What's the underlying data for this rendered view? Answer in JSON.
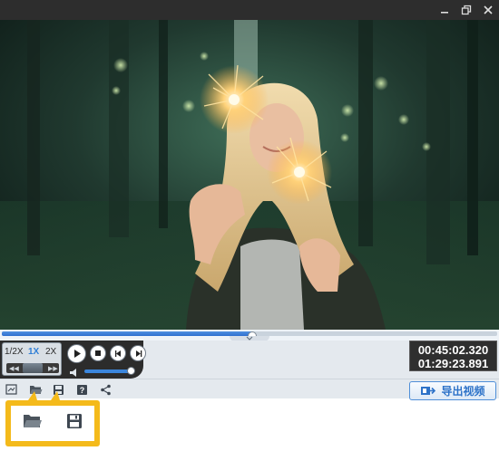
{
  "window": {
    "controls": [
      "minimize-icon",
      "restore-icon",
      "close-icon"
    ],
    "background": "#2b2b2b"
  },
  "video": {
    "description_icon": "video-frame",
    "playback_progress": 0.505
  },
  "speed": {
    "options": [
      "1/2X",
      "1X",
      "2X"
    ],
    "selected": "1X",
    "accent": "#2f7fd6"
  },
  "playback_buttons": [
    "play-icon",
    "stop-icon",
    "previous-frame-icon",
    "next-frame-icon"
  ],
  "volume": {
    "level": 0.95,
    "icon": "speaker-icon"
  },
  "time": {
    "current": "00:45:02.320",
    "total": "01:29:23.891"
  },
  "toolbar": {
    "icons": [
      "screenshot-icon",
      "open-folder-icon",
      "save-icon",
      "help-icon",
      "share-icon"
    ],
    "export_label": "导出视频",
    "export_icon": "export-icon",
    "export_color": "#2d72c8"
  },
  "callout": {
    "color": "#f4ba1b",
    "icons": [
      "open-folder-icon",
      "save-icon"
    ]
  }
}
